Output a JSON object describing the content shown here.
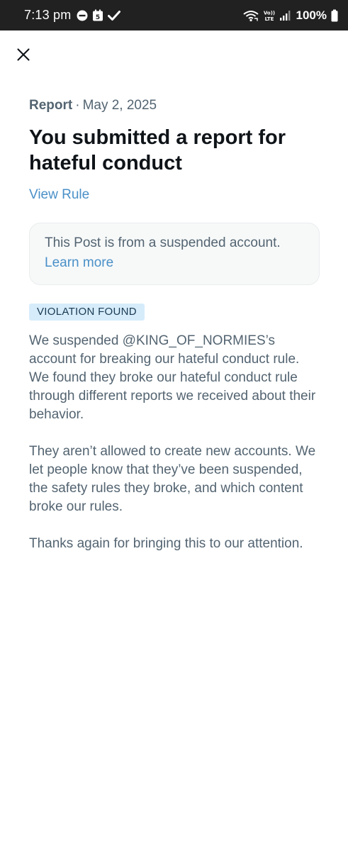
{
  "status_bar": {
    "time": "7:13 pm",
    "network_label": "VoLTE",
    "battery": "100%"
  },
  "report": {
    "label": "Report",
    "separator": "·",
    "date": "May 2, 2025",
    "headline": "You submitted a report for hateful conduct",
    "view_rule_link": "View Rule"
  },
  "notice": {
    "text": "This Post is from a suspended account.",
    "link": "Learn more"
  },
  "result": {
    "badge": "VIOLATION FOUND",
    "paragraphs": [
      "We suspended @KING_OF_NORMIES’s account for breaking our hateful conduct rule. We found they broke our hateful conduct rule through different reports we received about their behavior.",
      "They aren’t allowed to create new accounts. We let people know that they’ve been suspended, the safety rules they broke, and which content broke our rules.",
      "Thanks again for bringing this to our attention."
    ]
  },
  "colors": {
    "status_bar_bg": "#212121",
    "link": "#4a90c8",
    "badge_bg": "#d6ecfb",
    "secondary_text": "#536471",
    "primary_text": "#0f1419"
  },
  "icons": {
    "close": "close-icon",
    "dnd": "do-not-disturb-icon",
    "calendar": "calendar-icon",
    "check": "check-icon",
    "wifi": "wifi-calling-icon",
    "signal": "signal-icon",
    "battery": "battery-icon"
  }
}
